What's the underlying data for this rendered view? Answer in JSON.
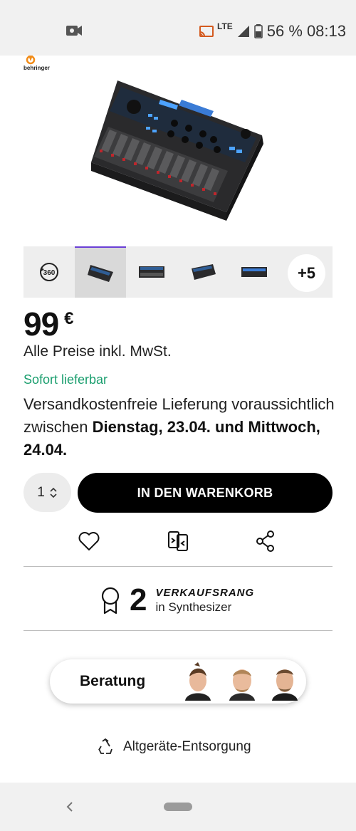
{
  "status_bar": {
    "network": "LTE",
    "battery": "56 %",
    "time": "08:13",
    "icons": [
      "video-record-icon",
      "cast-icon",
      "signal-icon",
      "battery-icon"
    ]
  },
  "product": {
    "brand_logo_text": "behringer",
    "thumbnails": [
      "360-view",
      "image-1",
      "image-2",
      "image-3",
      "image-4"
    ],
    "more_images_label": "+5",
    "price_value": "99",
    "price_currency": "€",
    "vat_note": "Alle Preise inkl. MwSt.",
    "availability": "Sofort lieferbar",
    "delivery_text_1": "Versandkostenfreie Lieferung voraussichtlich zwischen",
    "delivery_text_bold": "Dienstag, 23.04. und Mittwoch, 24.04."
  },
  "cart": {
    "quantity": "1",
    "add_to_cart_label": "IN DEN WARENKORB"
  },
  "actions": [
    "heart-icon",
    "compare-icon",
    "share-icon"
  ],
  "rank": {
    "number": "2",
    "title": "VERKAUFSRANG",
    "category": "in Synthesizer"
  },
  "advice": {
    "label": "Beratung"
  },
  "disposal": {
    "label": "Altgeräte-Entsorgung"
  },
  "colors": {
    "accent": "#6a3fd6",
    "availability": "#1a9e6e",
    "button": "#000000"
  }
}
